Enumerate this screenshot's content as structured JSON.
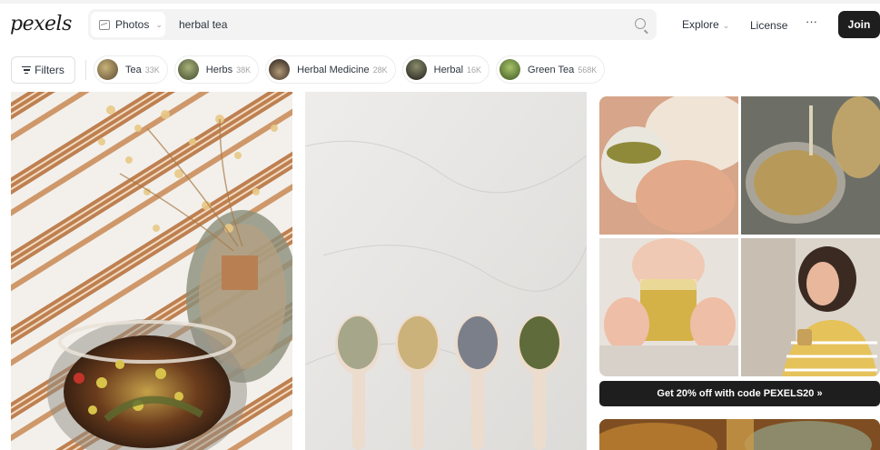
{
  "header": {
    "logo_text": "pexels",
    "search": {
      "type_label": "Photos",
      "value": "herbal tea",
      "type_icon": "image-icon",
      "submit_icon": "search-icon"
    },
    "nav": {
      "explore_label": "Explore",
      "license_label": "License",
      "more_label": "···",
      "join_label": "Join"
    }
  },
  "filter_bar": {
    "filters_label": "Filters",
    "filters_icon": "filter-lines-icon",
    "chips": [
      {
        "label": "Tea",
        "count": "33K",
        "thumb_color": "#6a5a3e"
      },
      {
        "label": "Herbs",
        "count": "38K",
        "thumb_color": "#5d6a42"
      },
      {
        "label": "Herbal Medicine",
        "count": "28K",
        "thumb_color": "#3b3028"
      },
      {
        "label": "Herbal",
        "count": "16K",
        "thumb_color": "#2d2d28"
      },
      {
        "label": "Green Tea",
        "count": "568K",
        "thumb_color": "#5c7a36"
      }
    ]
  },
  "promo": {
    "cta_label": "Get 20% off with code PEXELS20 »"
  },
  "colors": {
    "accent_dark": "#1e1e1e",
    "search_bg": "#f3f3f3"
  }
}
